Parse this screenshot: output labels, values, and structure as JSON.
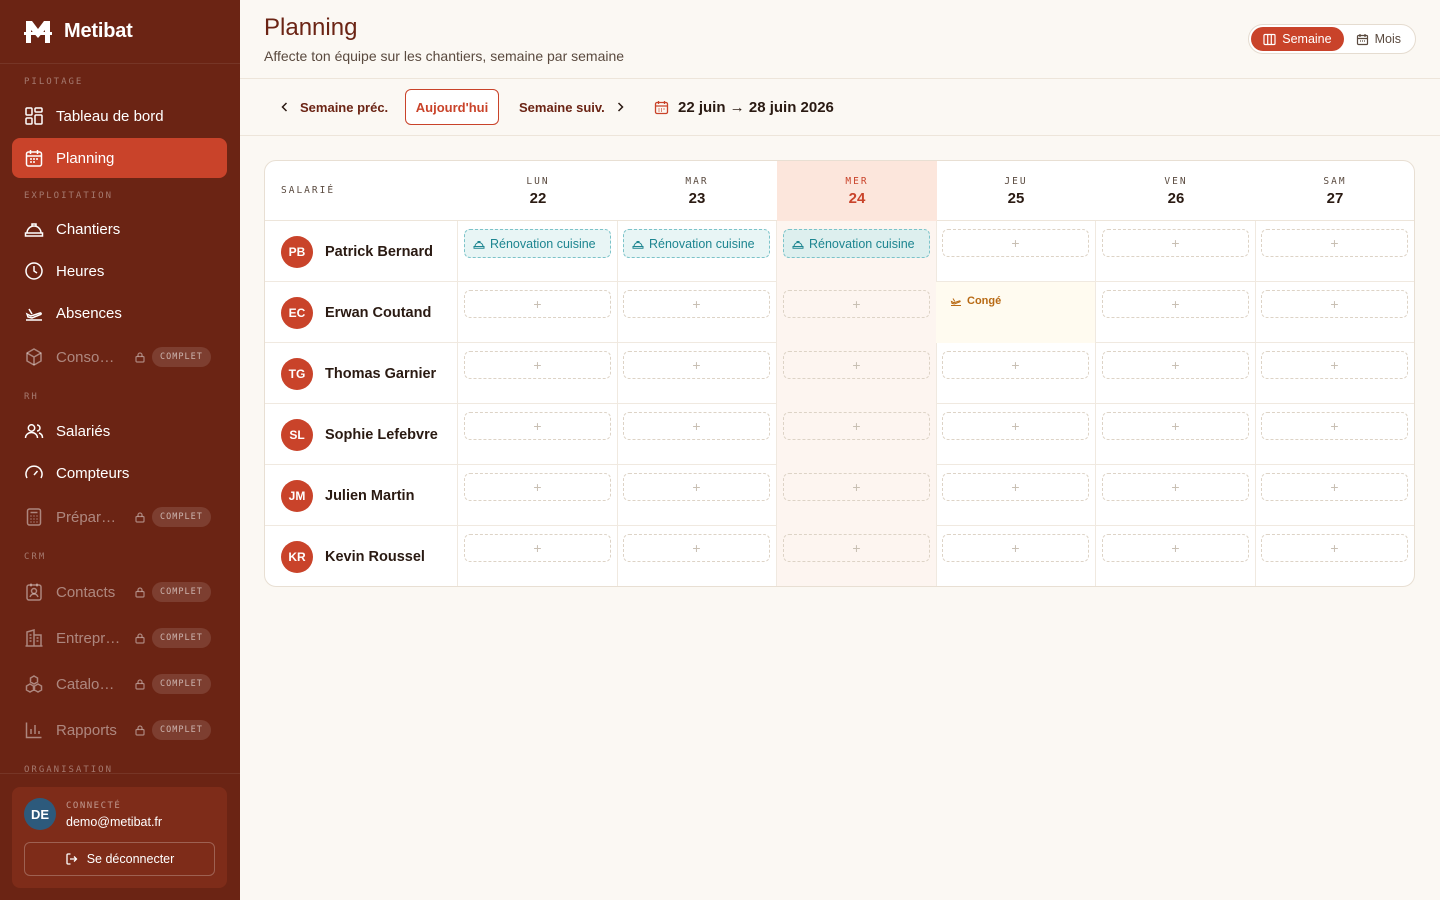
{
  "app": {
    "name": "Metibat"
  },
  "sidebar": {
    "sections": {
      "pilotage": "PILOTAGE",
      "exploitation": "EXPLOITATION",
      "rh": "RH",
      "crm": "CRM",
      "organisation": "ORGANISATION"
    },
    "items": {
      "dashboard": "Tableau de bord",
      "planning": "Planning",
      "chantiers": "Chantiers",
      "heures": "Heures",
      "absences": "Absences",
      "consommables": "Consommables",
      "salaries": "Salariés",
      "compteurs": "Compteurs",
      "preparation": "Préparation de paie",
      "contacts": "Contacts",
      "entreprises": "Entreprises",
      "catalogue": "Catalogue",
      "rapports": "Rapports"
    },
    "locked_badge": "COMPLET",
    "user": {
      "initials": "DE",
      "status": "CONNECTÉ",
      "email": "demo@metibat.fr",
      "logout": "Se déconnecter"
    }
  },
  "header": {
    "title": "Planning",
    "subtitle": "Affecte ton équipe sur les chantiers, semaine par semaine",
    "view_week": "Semaine",
    "view_month": "Mois"
  },
  "weekbar": {
    "prev": "Semaine préc.",
    "today": "Aujourd'hui",
    "next": "Semaine suiv.",
    "range": "22 juin → 28 juin 2026"
  },
  "grid": {
    "employee_header": "SALARIÉ",
    "days": [
      {
        "name": "LUN",
        "num": "22"
      },
      {
        "name": "MAR",
        "num": "23"
      },
      {
        "name": "MER",
        "num": "24"
      },
      {
        "name": "JEU",
        "num": "25"
      },
      {
        "name": "VEN",
        "num": "26"
      },
      {
        "name": "SAM",
        "num": "27"
      }
    ],
    "add_symbol": "+",
    "job_label": "Rénovation cuisine",
    "absence_label": "Congé",
    "employees": [
      {
        "initials": "PB",
        "name": "Patrick Bernard"
      },
      {
        "initials": "EC",
        "name": "Erwan Coutand"
      },
      {
        "initials": "TG",
        "name": "Thomas Garnier"
      },
      {
        "initials": "SL",
        "name": "Sophie Lefebvre"
      },
      {
        "initials": "JM",
        "name": "Julien Martin"
      },
      {
        "initials": "KR",
        "name": "Kevin Roussel"
      }
    ]
  },
  "colors": {
    "sidebar": "#6B2414",
    "accent": "#C9432A",
    "job": "#1D8590",
    "absence": "#B86A14"
  }
}
